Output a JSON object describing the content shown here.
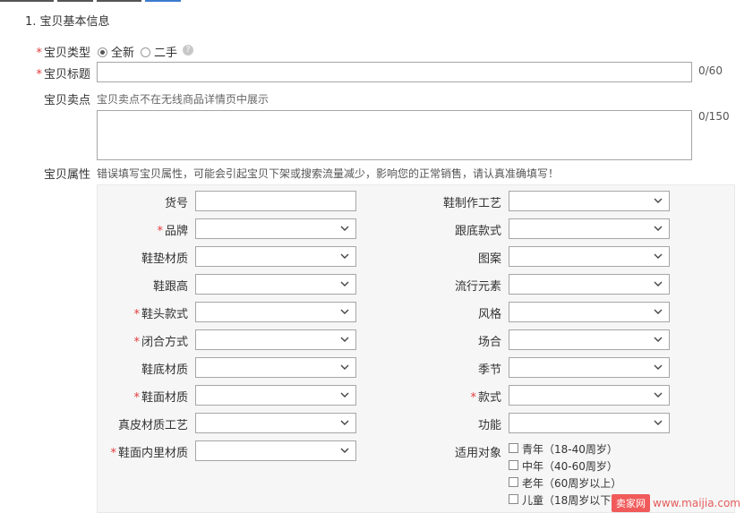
{
  "section_title": "1. 宝贝基本信息",
  "type": {
    "label": "宝贝类型",
    "options": [
      "全新",
      "二手"
    ],
    "selected": "全新"
  },
  "title": {
    "label": "宝贝标题",
    "value": "",
    "counter": "0/60"
  },
  "selling": {
    "label": "宝贝卖点",
    "hint": "宝贝卖点不在无线商品详情页中展示",
    "value": "",
    "counter": "0/150"
  },
  "attrs": {
    "label": "宝贝属性",
    "warning": "错误填写宝贝属性，可能会引起宝贝下架或搜索流量减少，影响您的正常销售，请认真准确填写！",
    "left": [
      {
        "label": "货号",
        "required": false,
        "kind": "input"
      },
      {
        "label": "品牌",
        "required": true,
        "kind": "select"
      },
      {
        "label": "鞋垫材质",
        "required": false,
        "kind": "select"
      },
      {
        "label": "鞋跟高",
        "required": false,
        "kind": "select"
      },
      {
        "label": "鞋头款式",
        "required": true,
        "kind": "select"
      },
      {
        "label": "闭合方式",
        "required": true,
        "kind": "select"
      },
      {
        "label": "鞋底材质",
        "required": false,
        "kind": "select"
      },
      {
        "label": "鞋面材质",
        "required": true,
        "kind": "select"
      },
      {
        "label": "真皮材质工艺",
        "required": false,
        "kind": "select"
      },
      {
        "label": "鞋面内里材质",
        "required": true,
        "kind": "select"
      }
    ],
    "right": [
      {
        "label": "鞋制作工艺",
        "required": false
      },
      {
        "label": "跟底款式",
        "required": false
      },
      {
        "label": "图案",
        "required": false
      },
      {
        "label": "流行元素",
        "required": false
      },
      {
        "label": "风格",
        "required": false
      },
      {
        "label": "场合",
        "required": false
      },
      {
        "label": "季节",
        "required": false
      },
      {
        "label": "款式",
        "required": true
      },
      {
        "label": "功能",
        "required": false
      }
    ],
    "audience": {
      "label": "适用对象",
      "options": [
        "青年（18-40周岁）",
        "中年（40-60周岁）",
        "老年（60周岁以上）",
        "儿童（18周岁以下）"
      ]
    }
  },
  "watermark": {
    "logo": "卖家网",
    "url": "www.maijia.com"
  },
  "icons": {
    "help": "help-icon",
    "chevron": "chevron-down-icon"
  },
  "colors": {
    "required": "#e4393c",
    "border": "#a6a6a6",
    "panel": "#f6f6f6"
  }
}
